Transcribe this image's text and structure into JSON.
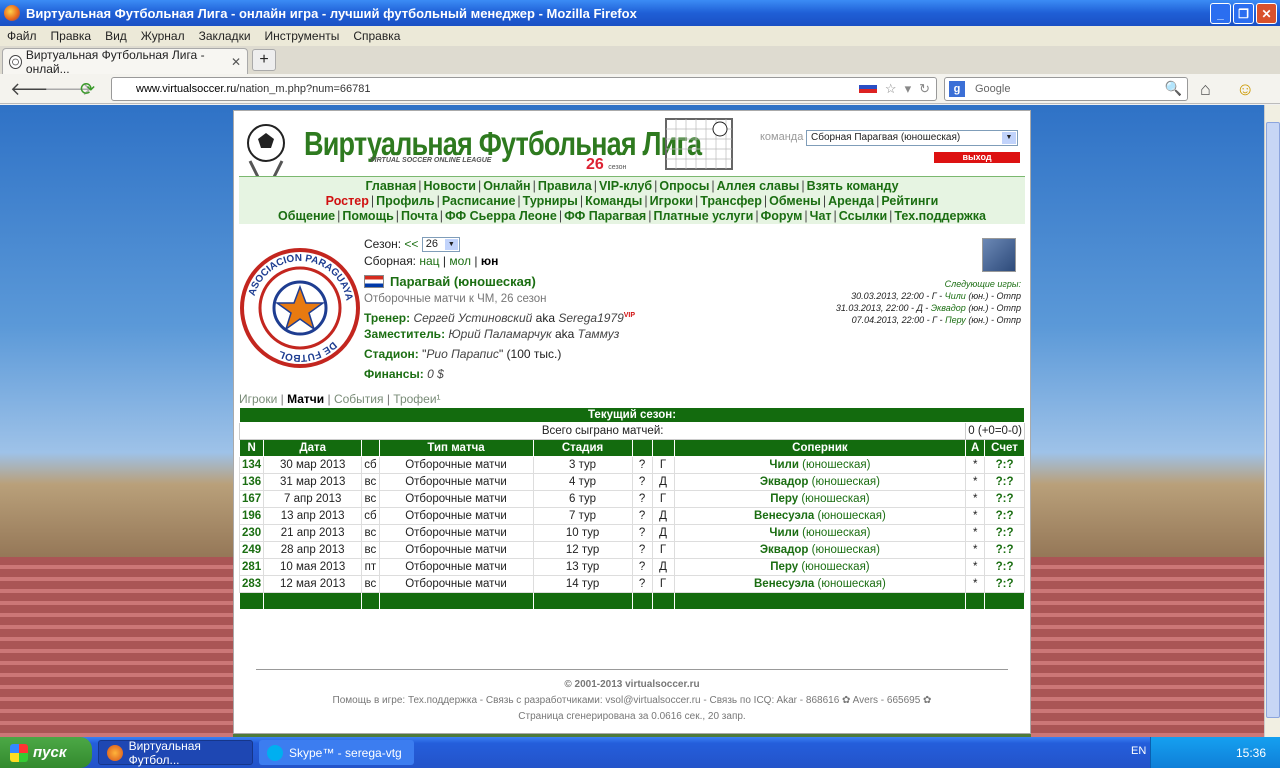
{
  "window": {
    "title": "Виртуальная Футбольная Лига - онлайн игра - лучший футбольный менеджер - Mozilla Firefox"
  },
  "menu": [
    "Файл",
    "Правка",
    "Вид",
    "Журнал",
    "Закладки",
    "Инструменты",
    "Справка"
  ],
  "tab": {
    "title": "Виртуальная Футбольная Лига - онлай..."
  },
  "url": {
    "domain": "www.virtualsoccer.ru",
    "path": "/nation_m.php?num=66781"
  },
  "search": {
    "placeholder": "Google"
  },
  "site": {
    "title": "Виртуальная Футбольная Лига",
    "subtitle": "VIRTUAL SOCCER ONLINE LEAGUE",
    "season_num": "26",
    "season_word": "сезон",
    "team_label": "команда",
    "team_selected": "Сборная Парагвая (юношеская)",
    "logout": "выход"
  },
  "nav": {
    "row1": [
      "Главная",
      "Новости",
      "Онлайн",
      "Правила",
      "VIP-клуб",
      "Опросы",
      "Аллея славы",
      "Взять команду"
    ],
    "row2": [
      "Ростер",
      "Профиль",
      "Расписание",
      "Турниры",
      "Команды",
      "Игроки",
      "Трансфер",
      "Обмены",
      "Аренда",
      "Рейтинги"
    ],
    "row3": [
      "Общение",
      "Помощь",
      "Почта",
      "ФФ Сьерра Леоне",
      "ФФ Парагвая",
      "Платные услуги",
      "Форум",
      "Чат",
      "Ссылки",
      "Тех.поддержка"
    ]
  },
  "team": {
    "season_label": "Сезон:",
    "season_prev": "<<",
    "season_value": "26",
    "squad_label": "Сборная:",
    "squad_nat": "нац",
    "squad_mol": "мол",
    "squad_yun": "юн",
    "name": "Парагвай (юношеская)",
    "competition": "Отборочные матчи к ЧМ, 26 сезон",
    "coach_label": "Тренер:",
    "coach_name": "Сергей Устиновский",
    "coach_aka": "aka",
    "coach_nick": "Serega1979",
    "coach_vip": "VIP",
    "deputy_label": "Заместитель:",
    "deputy_name": "Юрий Паламарчук",
    "deputy_aka": "aka",
    "deputy_nick": "Таммуз",
    "stadium_label": "Стадион:",
    "stadium_name": "Рио Парапис",
    "stadium_cap": "(100 тыс.)",
    "finance_label": "Финансы:",
    "finance_value": "0 $",
    "crest_text": "ASOCIACION PARAGUAYA DE FUTBOL"
  },
  "next_games": {
    "label": "Следующие игры:",
    "items": [
      {
        "dt": "30.03.2013, 22:00 - Г -",
        "opp": "Чили",
        "suffix": "(юн.) - Отпр"
      },
      {
        "dt": "31.03.2013, 22:00 - Д -",
        "opp": "Эквадор",
        "suffix": "(юн.) - Отпр"
      },
      {
        "dt": "07.04.2013, 22:00 - Г -",
        "opp": "Перу",
        "suffix": "(юн.) - Отпр"
      }
    ]
  },
  "subtabs": {
    "players": "Игроки",
    "matches": "Матчи",
    "events": "События",
    "trophies": "Трофеи¹"
  },
  "table": {
    "current_season": "Текущий сезон:",
    "played_label": "Всего сыграно матчей:",
    "played_value": "0 (+0=0-0)",
    "headers": {
      "n": "N",
      "date": "Дата",
      "type": "Тип матча",
      "stage": "Стадия",
      "opponent": "Соперник",
      "a": "А",
      "score": "Счет"
    },
    "rows": [
      {
        "n": "134",
        "date": "30 мар 2013",
        "dow": "сб",
        "type": "Отборочные матчи",
        "stage": "3 тур",
        "q": "?",
        "venue": "Г",
        "opp": "Чили",
        "opp_sfx": "(юношеская)",
        "a": "*",
        "score": "?:?"
      },
      {
        "n": "136",
        "date": "31 мар 2013",
        "dow": "вс",
        "type": "Отборочные матчи",
        "stage": "4 тур",
        "q": "?",
        "venue": "Д",
        "opp": "Эквадор",
        "opp_sfx": "(юношеская)",
        "a": "*",
        "score": "?:?"
      },
      {
        "n": "167",
        "date": "7 апр 2013",
        "dow": "вс",
        "type": "Отборочные матчи",
        "stage": "6 тур",
        "q": "?",
        "venue": "Г",
        "opp": "Перу",
        "opp_sfx": "(юношеская)",
        "a": "*",
        "score": "?:?"
      },
      {
        "n": "196",
        "date": "13 апр 2013",
        "dow": "сб",
        "type": "Отборочные матчи",
        "stage": "7 тур",
        "q": "?",
        "venue": "Д",
        "opp": "Венесуэла",
        "opp_sfx": "(юношеская)",
        "a": "*",
        "score": "?:?"
      },
      {
        "n": "230",
        "date": "21 апр 2013",
        "dow": "вс",
        "type": "Отборочные матчи",
        "stage": "10 тур",
        "q": "?",
        "venue": "Д",
        "opp": "Чили",
        "opp_sfx": "(юношеская)",
        "a": "*",
        "score": "?:?"
      },
      {
        "n": "249",
        "date": "28 апр 2013",
        "dow": "вс",
        "type": "Отборочные матчи",
        "stage": "12 тур",
        "q": "?",
        "venue": "Г",
        "opp": "Эквадор",
        "opp_sfx": "(юношеская)",
        "a": "*",
        "score": "?:?"
      },
      {
        "n": "281",
        "date": "10 мая 2013",
        "dow": "пт",
        "type": "Отборочные матчи",
        "stage": "13 тур",
        "q": "?",
        "venue": "Д",
        "opp": "Перу",
        "opp_sfx": "(юношеская)",
        "a": "*",
        "score": "?:?"
      },
      {
        "n": "283",
        "date": "12 мая 2013",
        "dow": "вс",
        "type": "Отборочные матчи",
        "stage": "14 тур",
        "q": "?",
        "venue": "Г",
        "opp": "Венесуэла",
        "opp_sfx": "(юношеская)",
        "a": "*",
        "score": "?:?"
      }
    ]
  },
  "footer": {
    "copyright": "© 2001-2013 virtualsoccer.ru",
    "help": "Помощь в игре: Тех.поддержка - Связь с разработчиками: vsol@virtualsoccer.ru - Связь по ICQ: Akar - 868616 ✿ Avers - 665695 ✿",
    "generated": "Страница сгенерирована за 0.0616 сек., 20 запр."
  },
  "taskbar": {
    "start": "пуск",
    "task1": "Виртуальная Футбол...",
    "task2": "Skype™ - serega-vtg",
    "lang": "EN",
    "clock": "15:36"
  }
}
